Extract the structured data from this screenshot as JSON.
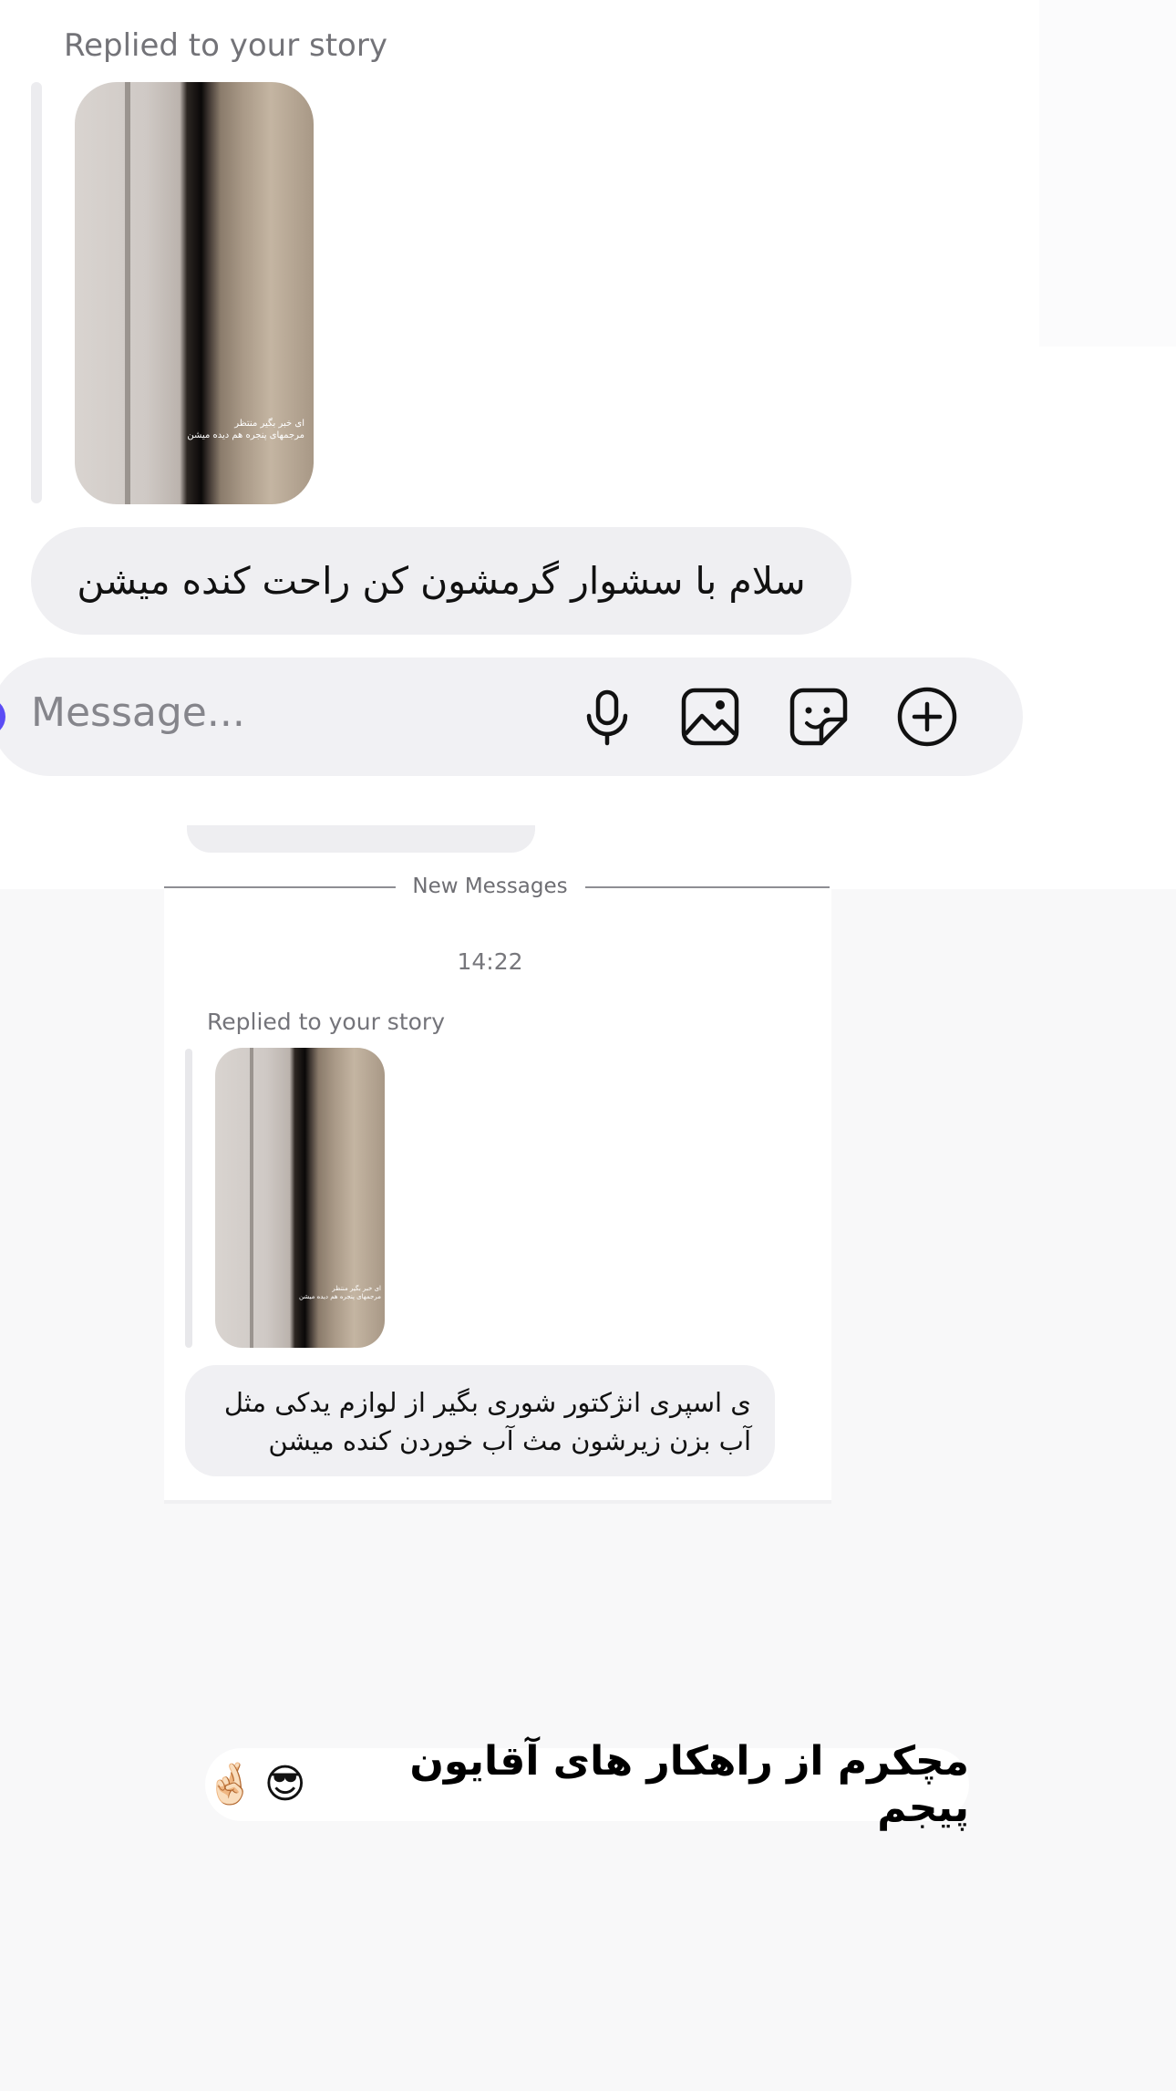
{
  "top": {
    "replied_label": "Replied to your story",
    "story_caption_line1": "ای خبر بگیر منتظر",
    "story_caption_line2": "مرجمهای پنجره هم دیده میشن",
    "message": "سلام با سشوار گرمشون کن راحت کنده میشن"
  },
  "composer": {
    "placeholder": "Message...",
    "icons": [
      "microphone-icon",
      "image-icon",
      "sticker-icon",
      "plus-circle-icon"
    ]
  },
  "lower": {
    "divider_label": "New Messages",
    "time": "14:22",
    "replied_label": "Replied to your story",
    "story_caption_line1": "ای خبر بگیر منتظر",
    "story_caption_line2": "مرجمهای پنجره هم دیده میشن",
    "message_line1": "ی اسپری انژکتور شوری بگیر از لوازم یدکی مثل",
    "message_line2": "آب بزن زیرشون مث آب خوردن کنده میشن"
  },
  "overlay": {
    "caption": "مچکرم از راهکار های آقایون پیجم",
    "emoji1": "😎",
    "emoji2": "🤞🏻"
  },
  "colors": {
    "accent": "#5b4cf5",
    "bubble": "#efeff2",
    "background": "#f8f8f9"
  }
}
